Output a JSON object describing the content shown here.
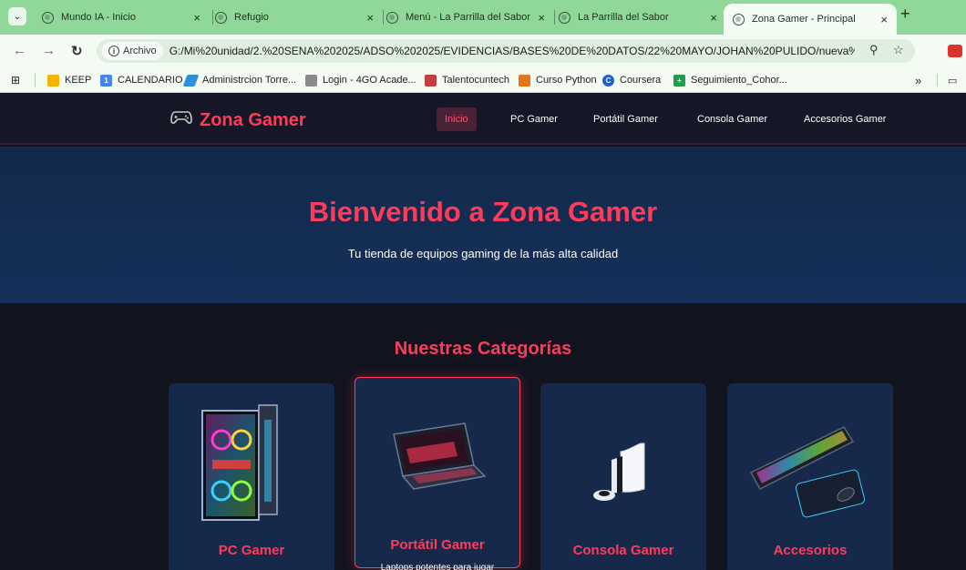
{
  "browser": {
    "tabs": [
      {
        "title": "Mundo IA - Inicio"
      },
      {
        "title": "Refugio"
      },
      {
        "title": "Menú - La Parrilla del Sabor"
      },
      {
        "title": "La Parrilla del Sabor"
      },
      {
        "title": "Zona Gamer - Principal",
        "active": true
      }
    ],
    "new_tab": "+",
    "chip_label": "Archivo",
    "url": "G:/Mi%20unidad/2.%20SENA%202025/ADSO%202025/EVIDENCIAS/BASES%20DE%20DATOS/22%20MAYO/JOHAN%20PULIDO/nueva%20pagina...",
    "bookmarks": [
      {
        "label": "KEEP",
        "color": "#f4b400"
      },
      {
        "label": "CALENDARIO",
        "color": "#4285f4"
      },
      {
        "label": "Administrcion Torre...",
        "color": "#2f8fdc"
      },
      {
        "label": "Login - 4GO Acade...",
        "color": "#8a8a8a"
      },
      {
        "label": "Talentocuntech",
        "color": "#c04040"
      },
      {
        "label": "Curso Python",
        "color": "#e8711c"
      },
      {
        "label": "Coursera",
        "color": "#1f5fd6"
      },
      {
        "label": "Seguimiento_Cohor...",
        "color": "#1e9e4a"
      }
    ],
    "more_bookmarks": "»"
  },
  "site": {
    "logo": "Zona Gamer",
    "nav": [
      "Inicio",
      "PC Gamer",
      "Portátil Gamer",
      "Consola Gamer",
      "Accesorios Gamer"
    ],
    "hero": {
      "title": "Bienvenido a Zona Gamer",
      "subtitle": "Tu tienda de equipos gaming de la más alta calidad"
    },
    "categories_title": "Nuestras Categorías",
    "categories": [
      {
        "title": "PC Gamer",
        "icon": "gaming-pc-icon"
      },
      {
        "title": "Portátil Gamer",
        "description": "Laptops potentes para jugar",
        "icon": "gaming-laptop-icon"
      },
      {
        "title": "Consola Gamer",
        "icon": "console-icon"
      },
      {
        "title": "Accesorios",
        "icon": "keyboard-mouse-icon"
      }
    ]
  },
  "colors": {
    "accent": "#ff3b5c",
    "nav_bg": "#151726",
    "hero_bg": "#12294a",
    "page_bg": "#11131f",
    "card_bg": "#16294a",
    "tabbar": "#8fd89a"
  }
}
